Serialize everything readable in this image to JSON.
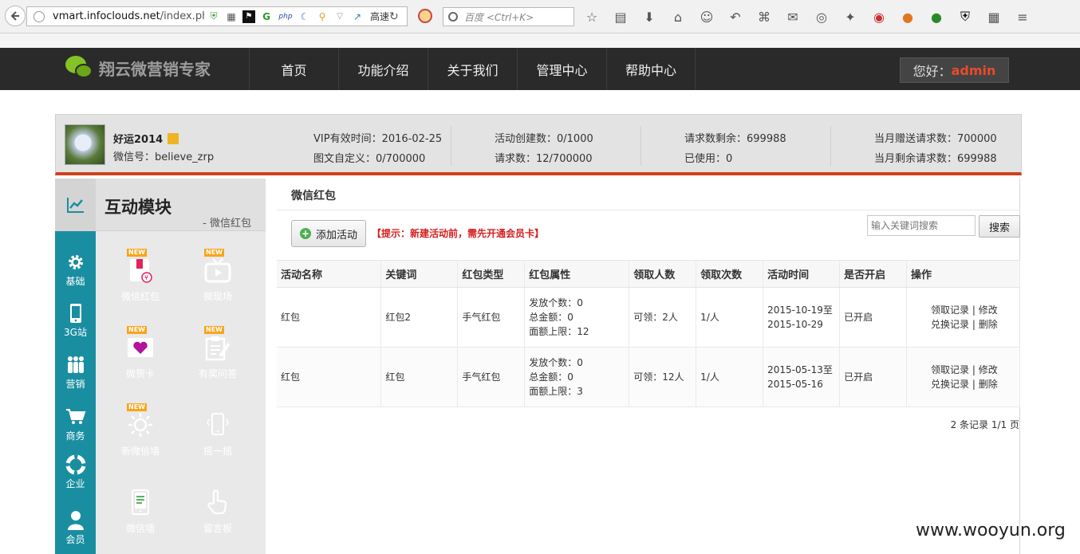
{
  "browser": {
    "url_host": "vmart.infoclouds.net",
    "url_path": "/index.php?g",
    "speed_label": "高速",
    "search_placeholder": "百度 <Ctrl+K>"
  },
  "site": {
    "brand": "翔云微营销专家",
    "nav": [
      "首页",
      "功能介绍",
      "关于我们",
      "管理中心",
      "帮助中心"
    ],
    "greeting_prefix": "您好：",
    "username": "admin"
  },
  "account": {
    "name": "好运2014",
    "wechat_id": "微信号：believe_zrp",
    "vip_expiry": "VIP有效时间：2016-02-25",
    "custom_pictext": "图文自定义：0/700000",
    "activities_created": "活动创建数：0/1000",
    "requests": "请求数：12/700000",
    "requests_remaining": "请求数剩余：699988",
    "used": "已使用：0",
    "monthly_gift_requests": "当月赠送请求数：700000",
    "monthly_remaining_requests": "当月剩余请求数：699988"
  },
  "sidebar": {
    "title": "互动模块",
    "subtitle": "- 微信红包",
    "categories": [
      "基础",
      "3G站",
      "营销",
      "商务",
      "企业",
      "会员"
    ],
    "tiles": [
      {
        "label": "微信红包",
        "new": "NEW",
        "color": "#e0245e",
        "icon": "red-envelope-icon"
      },
      {
        "label": "微现场",
        "new": "NEW",
        "color": "#2f8fdc",
        "icon": "tv-icon"
      },
      {
        "label": "微贺卡",
        "new": "NEW",
        "color": "#b1139b",
        "icon": "heart-card-icon"
      },
      {
        "label": "有奖问答",
        "new": "NEW",
        "color": "#2f8fdc",
        "icon": "clipboard-edit-icon"
      },
      {
        "label": "新微信墙",
        "new": "NEW",
        "color": "#1a8ea1",
        "icon": "sun-icon"
      },
      {
        "label": "摇一摇",
        "new": "",
        "color": "#d0421b",
        "icon": "phone-shake-icon"
      },
      {
        "label": "微信墙",
        "new": "",
        "color": "#1a9e26",
        "icon": "tablet-icon"
      },
      {
        "label": "留言板",
        "new": "",
        "color": "#6a3fb0",
        "icon": "hand-pointer-icon"
      }
    ]
  },
  "main": {
    "page_title": "微信红包",
    "add_button": "添加活动",
    "tip": "【提示：新建活动前，需先开通会员卡】",
    "search_placeholder": "输入关键词搜索",
    "search_button": "搜索",
    "columns": [
      "活动名称",
      "关键词",
      "红包类型",
      "红包属性",
      "领取人数",
      "领取次数",
      "活动时间",
      "是否开启",
      "操作"
    ],
    "rows": [
      {
        "name": "红包",
        "keyword": "红包2",
        "type": "手气红包",
        "attr_count": "发放个数：0",
        "attr_total": "总金额：0",
        "attr_cap": "面额上限：12",
        "people": "可领：2人",
        "times": "1/人",
        "time_start": "2015-10-19至",
        "time_end": "2015-10-29",
        "status": "已开启",
        "op_records": "领取记录",
        "op_edit": "修改",
        "op_redeem": "兑换记录",
        "op_delete": "删除"
      },
      {
        "name": "红包",
        "keyword": "红包",
        "type": "手气红包",
        "attr_count": "发放个数：0",
        "attr_total": "总金额：0",
        "attr_cap": "面额上限：3",
        "people": "可领：12人",
        "times": "1/人",
        "time_start": "2015-05-13至",
        "time_end": "2015-05-16",
        "status": "已开启",
        "op_records": "领取记录",
        "op_edit": "修改",
        "op_redeem": "兑换记录",
        "op_delete": "删除"
      }
    ],
    "pagination": "2 条记录 1/1 页"
  },
  "watermark": "www.wooyun.org"
}
